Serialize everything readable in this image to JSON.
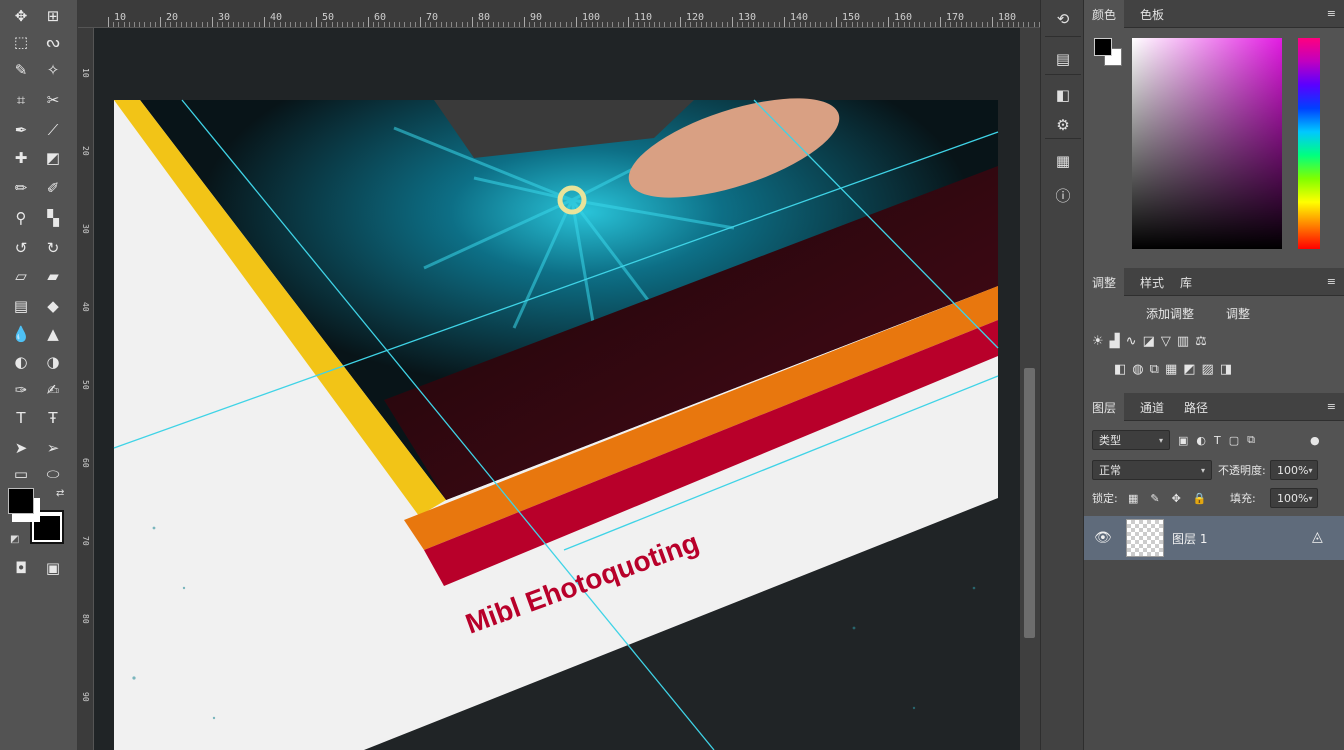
{
  "ruler": {
    "top_ticks": [
      "10",
      "20",
      "30",
      "40",
      "50",
      "60",
      "70",
      "80",
      "90",
      "100",
      "110",
      "120",
      "130",
      "140",
      "150",
      "160",
      "170",
      "180"
    ],
    "left_ticks": [
      "10",
      "20",
      "30",
      "40",
      "50",
      "60",
      "70",
      "80",
      "90"
    ]
  },
  "toolbar": {
    "tools": [
      {
        "name": "move-tool-icon",
        "glyph": "✥"
      },
      {
        "name": "artboard-tool-icon",
        "glyph": "⊞"
      },
      {
        "name": "marquee-tool-icon",
        "glyph": "⬚"
      },
      {
        "name": "lasso-tool-icon",
        "glyph": "ᔓ"
      },
      {
        "name": "quick-select-tool-icon",
        "glyph": "✎"
      },
      {
        "name": "magic-wand-tool-icon",
        "glyph": "✧"
      },
      {
        "name": "crop-tool-icon",
        "glyph": "⌗"
      },
      {
        "name": "slice-tool-icon",
        "glyph": "✂"
      },
      {
        "name": "eyedropper-tool-icon",
        "glyph": "✒"
      },
      {
        "name": "ruler-tool-icon",
        "glyph": "⟋"
      },
      {
        "name": "healing-brush-tool-icon",
        "glyph": "✚"
      },
      {
        "name": "patch-tool-icon",
        "glyph": "◩"
      },
      {
        "name": "brush-tool-icon",
        "glyph": "✏"
      },
      {
        "name": "pencil-tool-icon",
        "glyph": "✐"
      },
      {
        "name": "clone-stamp-tool-icon",
        "glyph": "⚲"
      },
      {
        "name": "pattern-stamp-tool-icon",
        "glyph": "▚"
      },
      {
        "name": "history-brush-tool-icon",
        "glyph": "↺"
      },
      {
        "name": "art-history-brush-tool-icon",
        "glyph": "↻"
      },
      {
        "name": "eraser-tool-icon",
        "glyph": "▱"
      },
      {
        "name": "bg-eraser-tool-icon",
        "glyph": "▰"
      },
      {
        "name": "gradient-tool-icon",
        "glyph": "▤"
      },
      {
        "name": "paint-bucket-tool-icon",
        "glyph": "◆"
      },
      {
        "name": "blur-tool-icon",
        "glyph": "💧"
      },
      {
        "name": "sharpen-tool-icon",
        "glyph": "▲"
      },
      {
        "name": "dodge-tool-icon",
        "glyph": "◐"
      },
      {
        "name": "burn-tool-icon",
        "glyph": "◑"
      },
      {
        "name": "pen-tool-icon",
        "glyph": "✑"
      },
      {
        "name": "freeform-pen-tool-icon",
        "glyph": "✍"
      },
      {
        "name": "type-tool-icon",
        "glyph": "T"
      },
      {
        "name": "vertical-type-tool-icon",
        "glyph": "Ŧ"
      },
      {
        "name": "path-select-tool-icon",
        "glyph": "➤"
      },
      {
        "name": "direct-select-tool-icon",
        "glyph": "➢"
      },
      {
        "name": "rectangle-tool-icon",
        "glyph": "▭"
      },
      {
        "name": "ellipse-tool-icon",
        "glyph": "⬭"
      },
      {
        "name": "hand-tool-icon",
        "glyph": "☚"
      },
      {
        "name": "rotate-view-tool-icon",
        "glyph": "⟲"
      },
      {
        "name": "zoom-tool-icon",
        "glyph": "⌕"
      },
      {
        "name": "edit-toolbar-icon",
        "glyph": "⋯"
      }
    ],
    "quick_mask_glyph": "◘",
    "screen_mode_glyph": "▣"
  },
  "canvas": {
    "headline": "Mibl Ehotoquoting",
    "colors": {
      "yellow": "#f2c417",
      "orange": "#e8770e",
      "red": "#b8002a",
      "cyan_guide": "#3fd3e6",
      "paper": "#f1f1f1"
    }
  },
  "dock": {
    "icons": [
      "history-icon",
      "actions-icon",
      "adjust-icon",
      "brush-preset-icon",
      "properties-icon",
      "info-icon"
    ],
    "glyphs": [
      "⟲",
      "▤",
      "◧",
      "⚙",
      "▦",
      "ⓘ"
    ]
  },
  "panels": {
    "color": {
      "tabs": [
        "颜色",
        "色板"
      ],
      "menu": "≡"
    },
    "adjustments": {
      "tabs": [
        "调整",
        "样式",
        "库"
      ],
      "menu": "≡",
      "section_label": "添加调整",
      "sub_label": "调整"
    },
    "layers": {
      "tabs": [
        "图层",
        "通道",
        "路径"
      ],
      "menu": "≡",
      "filter_label": "类型",
      "blend_mode": "正常",
      "opacity_label": "不透明度:",
      "opacity_value": "100%",
      "lock_label": "锁定:",
      "fill_label": "填充:",
      "fill_value": "100%",
      "layer_name": "图层 1"
    }
  }
}
